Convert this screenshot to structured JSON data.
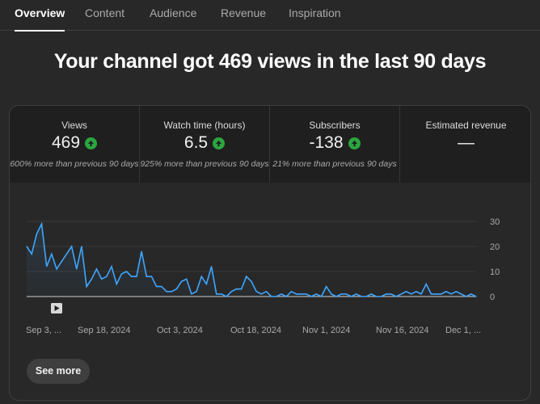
{
  "tabs": [
    {
      "label": "Overview",
      "active": true
    },
    {
      "label": "Content",
      "active": false
    },
    {
      "label": "Audience",
      "active": false
    },
    {
      "label": "Revenue",
      "active": false
    },
    {
      "label": "Inspiration",
      "active": false
    }
  ],
  "headline": "Your channel got 469 views in the last 90 days",
  "metrics": [
    {
      "label": "Views",
      "value": "469",
      "trend_icon": "arrow-up-icon",
      "note": "600% more than previous 90 days"
    },
    {
      "label": "Watch time (hours)",
      "value": "6.5",
      "trend_icon": "arrow-up-icon",
      "note": "925% more than previous 90 days"
    },
    {
      "label": "Subscribers",
      "value": "-138",
      "trend_icon": "arrow-up-icon",
      "note": "21% more than previous 90 days"
    },
    {
      "label": "Estimated revenue",
      "value": "—",
      "note": ""
    }
  ],
  "colors": {
    "background": "#282828",
    "metric_tile": "#1f1f1f",
    "line": "#3ea6ff",
    "trend_up": "#2ba640"
  },
  "see_more_label": "See more",
  "play_icon": "play-icon",
  "chart_data": {
    "type": "area",
    "title": "",
    "xlabel": "",
    "ylabel": "",
    "ylim": [
      0,
      30
    ],
    "yticks": [
      0,
      10,
      20,
      30
    ],
    "y_axis_side": "right",
    "grid": true,
    "xtick_labels": [
      "Sep 3, ...",
      "Sep 18, 2024",
      "Oct 3, 2024",
      "Oct 18, 2024",
      "Nov 1, 2024",
      "Nov 16, 2024",
      "Dec 1, ..."
    ],
    "x_start_label": "Sep 3, 2024",
    "series": [
      {
        "name": "",
        "values": [
          20,
          17,
          25,
          29,
          12,
          17,
          11,
          14,
          17,
          20,
          11,
          20,
          4,
          7,
          11,
          7,
          8,
          12,
          5,
          9,
          10,
          8,
          8,
          18,
          8,
          8,
          4,
          4,
          2,
          2,
          3,
          6,
          7,
          1,
          2,
          8,
          5,
          12,
          1,
          1,
          0,
          2,
          3,
          3,
          8,
          6,
          2,
          1,
          2,
          0,
          0,
          1,
          0,
          2,
          1,
          1,
          1,
          0,
          1,
          0,
          4,
          1,
          0,
          1,
          1,
          0,
          1,
          0,
          0,
          1,
          0,
          0,
          1,
          1,
          0,
          1,
          2,
          1,
          2,
          1,
          5,
          1,
          1,
          1,
          2,
          1,
          2,
          1,
          0,
          1,
          0
        ]
      }
    ]
  }
}
